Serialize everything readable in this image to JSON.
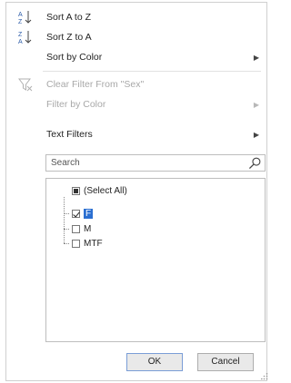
{
  "menu": {
    "sort_az": "Sort A to Z",
    "sort_za": "Sort Z to A",
    "sort_by_color": "Sort by Color",
    "clear_filter": "Clear Filter From \"Sex\"",
    "filter_by_color": "Filter by Color",
    "text_filters": "Text Filters"
  },
  "search": {
    "placeholder": "Search"
  },
  "list": {
    "select_all": "(Select All)",
    "items": [
      "F",
      "M",
      "MTF"
    ]
  },
  "buttons": {
    "ok": "OK",
    "cancel": "Cancel"
  },
  "colors": {
    "selection": "#2b6fd1",
    "sort_icon": "#2a5aa8"
  }
}
